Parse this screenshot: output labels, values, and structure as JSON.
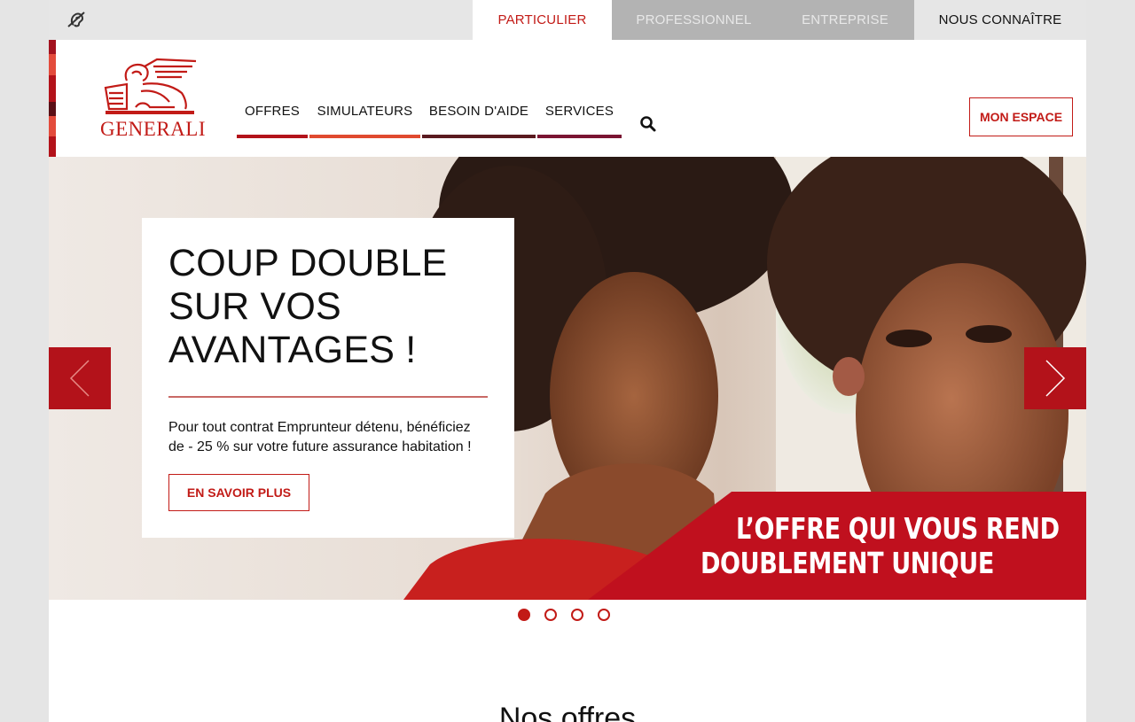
{
  "topbar": {
    "accessibility_icon": "hearing-impaired-icon",
    "segments": [
      {
        "label": "PARTICULIER",
        "active": true
      },
      {
        "label": "PROFESSIONNEL",
        "active": false
      },
      {
        "label": "ENTREPRISE",
        "active": false
      },
      {
        "label": "NOUS CONNAÎTRE",
        "active": false
      }
    ]
  },
  "header": {
    "logo_text": "GENERALI",
    "nav": [
      {
        "label": "OFFRES",
        "color": "#b3121a"
      },
      {
        "label": "SIMULATEURS",
        "color": "#e04a2f"
      },
      {
        "label": "BESOIN D'AIDE",
        "color": "#5a1a1f"
      },
      {
        "label": "SERVICES",
        "color": "#7a1432"
      }
    ],
    "search_icon": "search-icon",
    "account_label": "MON ESPACE"
  },
  "hero": {
    "title_lines": [
      "COUP DOUBLE",
      "SUR VOS",
      "AVANTAGES !"
    ],
    "description_lines": [
      "Pour tout contrat Emprunteur détenu, bénéficiez",
      "de - 25 % sur votre future assurance habitation !"
    ],
    "cta_label": "EN SAVOIR PLUS",
    "banner_lines": [
      "L’OFFRE QUI VOUS REND",
      "DOUBLEMENT UNIQUE"
    ],
    "prev_icon": "chevron-left-icon",
    "next_icon": "chevron-right-icon",
    "slides_total": 4,
    "active_slide": 1
  },
  "offers": {
    "title": "Nos offres"
  },
  "colors": {
    "brand_red": "#c21b17",
    "arrow_red": "#b3121a",
    "banner_red": "#c0101e"
  }
}
